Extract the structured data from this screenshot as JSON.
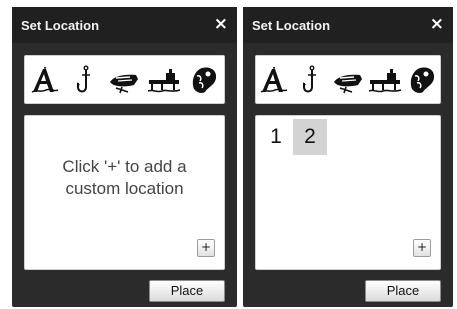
{
  "colors": {
    "panel_bg": "#2b2b2b",
    "titlebar_bg": "#202020",
    "selected_item_bg": "#d3d3d3"
  },
  "tool_icons": [
    "compass-anchor-icon",
    "fishing-hook-icon",
    "lure-icon",
    "dock-icon",
    "fish-icon"
  ],
  "left_panel": {
    "title": "Set Location",
    "close_label": "×",
    "empty_message": "Click '+' to add a custom location",
    "add_label": "+",
    "place_label": "Place"
  },
  "right_panel": {
    "title": "Set Location",
    "close_label": "×",
    "locations": [
      {
        "label": "1",
        "selected": false
      },
      {
        "label": "2",
        "selected": true
      }
    ],
    "add_label": "+",
    "place_label": "Place"
  }
}
